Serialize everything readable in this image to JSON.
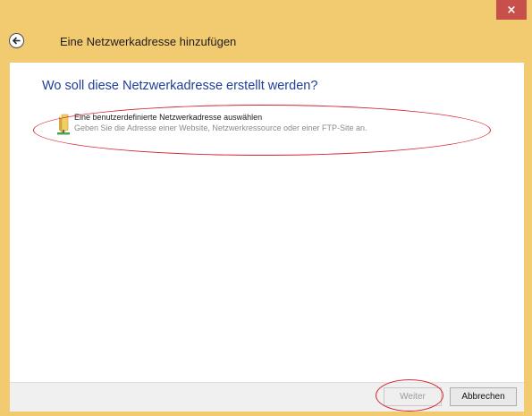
{
  "window": {
    "close_label": "×"
  },
  "header": {
    "title": "Eine Netzwerkadresse hinzufügen"
  },
  "main": {
    "question": "Wo soll diese Netzwerkadresse erstellt werden?",
    "option": {
      "title": "Eine benutzerdefinierte Netzwerkadresse auswählen",
      "description": "Geben Sie die Adresse einer Website, Netzwerkressource oder einer FTP-Site an."
    }
  },
  "footer": {
    "next_label": "Weiter",
    "cancel_label": "Abbrechen"
  },
  "colors": {
    "frame": "#f2ca6f",
    "close": "#c7504a",
    "heading": "#1e3f97",
    "highlight": "#d6232f"
  },
  "icons": {
    "back": "back-arrow-icon",
    "option": "network-folder-icon"
  }
}
